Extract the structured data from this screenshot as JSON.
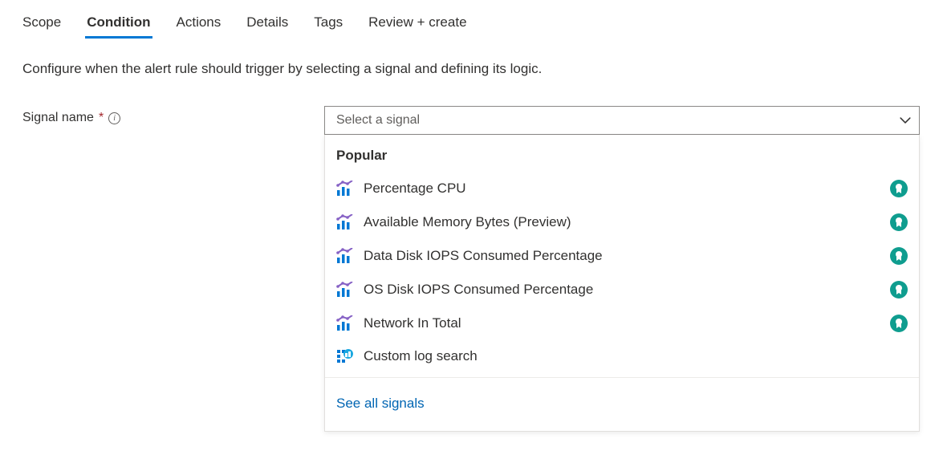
{
  "tabs": {
    "scope": "Scope",
    "condition": "Condition",
    "actions": "Actions",
    "details": "Details",
    "tags": "Tags",
    "review": "Review + create"
  },
  "description": "Configure when the alert rule should trigger by selecting a signal and defining its logic.",
  "field": {
    "label": "Signal name",
    "required_mark": "*"
  },
  "combo": {
    "placeholder": "Select a signal"
  },
  "dropdown": {
    "group_header": "Popular",
    "options": [
      {
        "label": "Percentage CPU",
        "type": "metric",
        "badge": true
      },
      {
        "label": "Available Memory Bytes (Preview)",
        "type": "metric",
        "badge": true
      },
      {
        "label": "Data Disk IOPS Consumed Percentage",
        "type": "metric",
        "badge": true
      },
      {
        "label": "OS Disk IOPS Consumed Percentage",
        "type": "metric",
        "badge": true
      },
      {
        "label": "Network In Total",
        "type": "metric",
        "badge": true
      },
      {
        "label": "Custom log search",
        "type": "log",
        "badge": false
      }
    ],
    "see_all": "See all signals"
  }
}
